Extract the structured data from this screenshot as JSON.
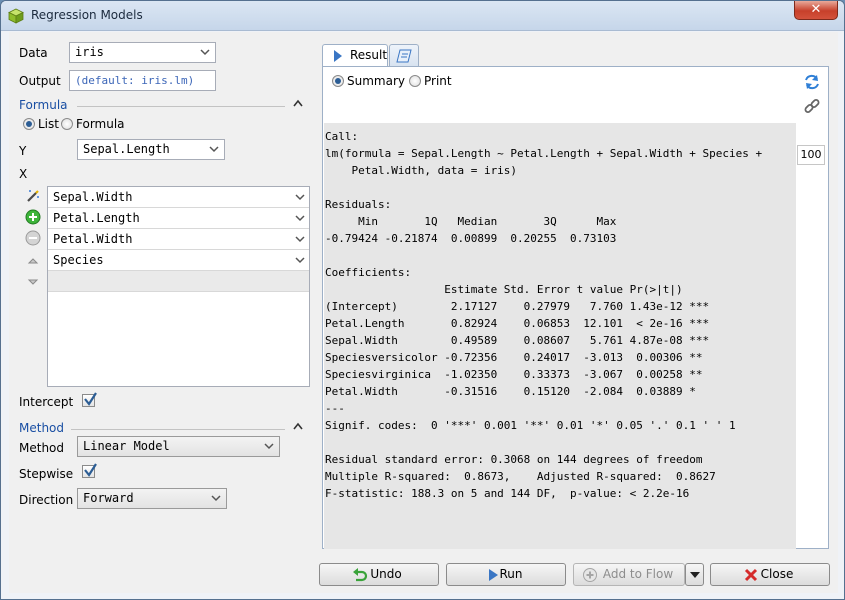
{
  "window": {
    "title": "Regression Models",
    "close_glyph": "✕"
  },
  "form": {
    "data_label": "Data",
    "data_value": "iris",
    "output_label": "Output",
    "output_placeholder": "(default: iris.lm)",
    "formula_section": "Formula",
    "mode_list": "List",
    "mode_formula": "Formula",
    "mode_selected": "List",
    "y_label": "Y",
    "y_value": "Sepal.Length",
    "x_label": "X",
    "x_items": [
      "Sepal.Width",
      "Petal.Length",
      "Petal.Width",
      "Species"
    ],
    "intercept_label": "Intercept",
    "intercept_checked": true,
    "method_section": "Method",
    "method_label": "Method",
    "method_value": "Linear Model",
    "stepwise_label": "Stepwise",
    "stepwise_checked": true,
    "direction_label": "Direction",
    "direction_value": "Forward"
  },
  "icons": {
    "app": "cube-icon",
    "wand": "magic-wand-icon",
    "add": "add-icon",
    "remove": "remove-icon",
    "up": "move-up-icon",
    "down": "move-down-icon",
    "refresh": "refresh-icon",
    "link": "link-icon"
  },
  "result": {
    "tab_result": "Result",
    "view_summary": "Summary",
    "view_print": "Print",
    "view_selected": "Summary",
    "digits": "100",
    "text": "Call:\nlm(formula = Sepal.Length ~ Petal.Length + Sepal.Width + Species +\n    Petal.Width, data = iris)\n\nResiduals:\n     Min       1Q   Median       3Q      Max\n-0.79424 -0.21874  0.00899  0.20255  0.73103\n\nCoefficients:\n                  Estimate Std. Error t value Pr(>|t|)\n(Intercept)        2.17127    0.27979   7.760 1.43e-12 ***\nPetal.Length       0.82924    0.06853  12.101  < 2e-16 ***\nSepal.Width        0.49589    0.08607   5.761 4.87e-08 ***\nSpeciesversicolor -0.72356    0.24017  -3.013  0.00306 **\nSpeciesvirginica  -1.02350    0.33373  -3.067  0.00258 **\nPetal.Width       -0.31516    0.15120  -2.084  0.03889 *\n---\nSignif. codes:  0 '***' 0.001 '**' 0.01 '*' 0.05 '.' 0.1 ' ' 1\n\nResidual standard error: 0.3068 on 144 degrees of freedom\nMultiple R-squared:  0.8673,    Adjusted R-squared:  0.8627\nF-statistic: 188.3 on 5 and 144 DF,  p-value: < 2.2e-16"
  },
  "buttons": {
    "undo": "Undo",
    "run": "Run",
    "add_to_flow": "Add to Flow",
    "close": "Close"
  }
}
